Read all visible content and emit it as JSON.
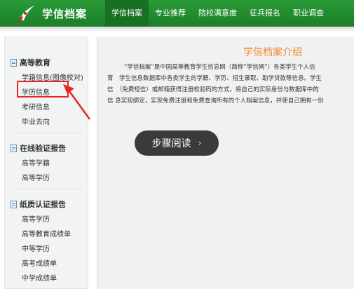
{
  "header": {
    "brand": "学信档案",
    "nav": [
      {
        "label": "学信档案",
        "active": true
      },
      {
        "label": "专业推荐",
        "active": false
      },
      {
        "label": "院校满意度",
        "active": false
      },
      {
        "label": "征兵报名",
        "active": false
      },
      {
        "label": "职业调查",
        "active": false
      }
    ]
  },
  "sidebar": {
    "groups": [
      {
        "title": "高等教育",
        "items": [
          "学籍信息(图像校对)",
          "学历信息",
          "考研信息",
          "毕业去向"
        ]
      },
      {
        "title": "在线验证报告",
        "items": [
          "高等学籍",
          "高等学历"
        ]
      },
      {
        "title": "纸质认证报告",
        "items": [
          "高等学历",
          "高等教育成绩单",
          "中等学历",
          "高考成绩单",
          "中学成绩单"
        ]
      }
    ]
  },
  "main": {
    "title": "学信档案介绍",
    "lines": [
      "“学信档案”是中国高等教育学生信息网（简称“学信网”）各类学生个人信",
      "育　学生信息数据库中各类学生的学籍、学历、招生录取、助学贷款等信息。学生",
      "信　（免费短信）或邮箱获得注册校验码的方式，将自己的实际身份与数据库中的",
      "信 息实现绑定，实现免费注册和免费查询所有的个人档案信息，并使自己拥有一份"
    ]
  },
  "overlay": {
    "step_label": "步骤阅读",
    "chevron": "›"
  },
  "colors": {
    "header_green": "#1f8a2e",
    "title_orange": "#f08a2c",
    "highlight_red": "#e8242a"
  }
}
